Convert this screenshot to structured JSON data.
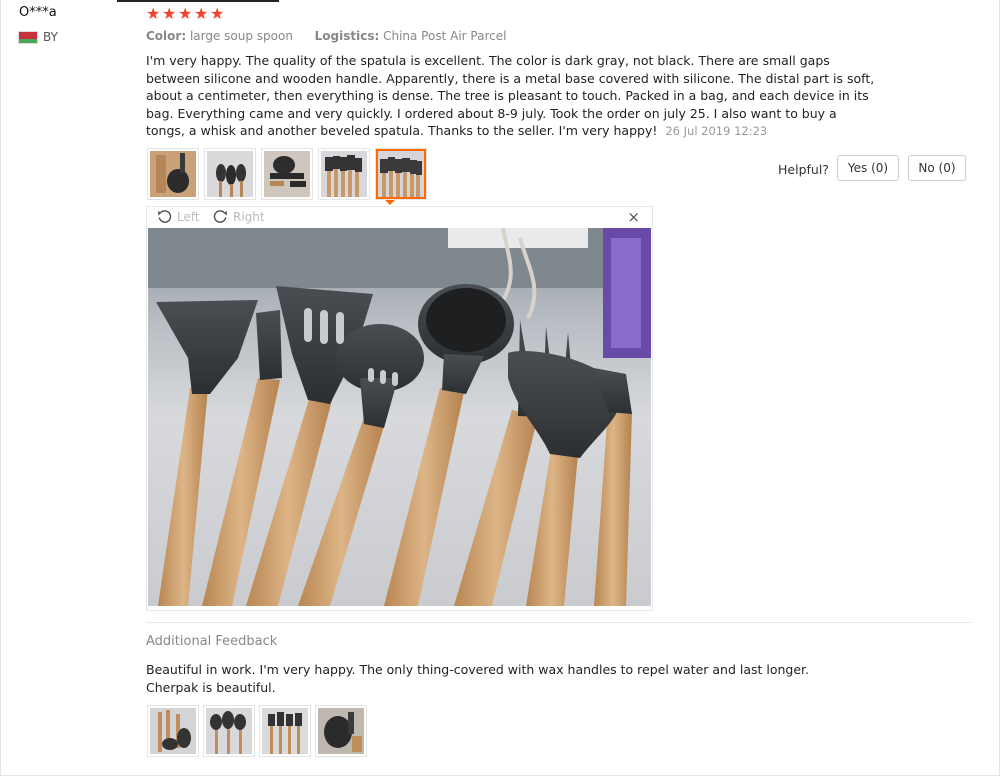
{
  "reviewer": {
    "name": "O***a",
    "country": "BY"
  },
  "rating": {
    "stars": 5,
    "max": 5
  },
  "attributes": {
    "color_label": "Color:",
    "color_value": "large soup spoon",
    "logistics_label": "Logistics:",
    "logistics_value": "China Post Air Parcel"
  },
  "review": {
    "text": "I'm very happy. The quality of the spatula is excellent. The color is dark gray, not black. There are small gaps between silicone and wooden handle. Apparently, there is a metal base covered with silicone. The distal part is soft, about a centimeter, then everything is dense. The tree is pleasant to touch. Packed in a bag, and each device in its bag. Everything came and very quickly. I ordered about 8-9 july. Took the order on july 25. I also want to buy a tongs, a whisk and another beveled spatula. Thanks to the seller. I'm very happy!",
    "date": "26 Jul 2019 12:23"
  },
  "helpful": {
    "label": "Helpful?",
    "yes_label": "Yes (0)",
    "no_label": "No (0)"
  },
  "viewer": {
    "rotate_left": "Left",
    "rotate_right": "Right",
    "close_glyph": "×"
  },
  "additional": {
    "title": "Additional Feedback",
    "text_line1": "Beautiful in work. I'm very happy. The only thing-covered with wax handles to repel water and last longer.",
    "text_line2": "Cherpak is beautiful."
  },
  "colors": {
    "star": "#f44336",
    "active_border": "#ff6a00",
    "muted_text": "#888888"
  }
}
